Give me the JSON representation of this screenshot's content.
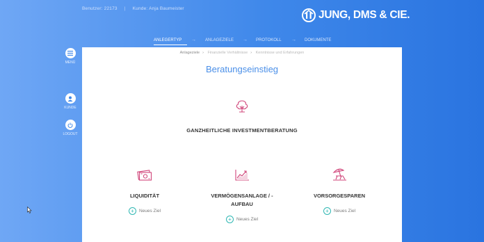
{
  "header": {
    "user_label": "Benutzer: 22173",
    "separator": "|",
    "customer_label": "Kunde: Anja Baumeister",
    "logo_text": "JUNG, DMS & CIE."
  },
  "steps": [
    {
      "label": "ANLEGERTYP",
      "active": true
    },
    {
      "label": "ANLAGEZIELE",
      "active": false
    },
    {
      "label": "PROTOKOLL",
      "active": false
    },
    {
      "label": "DOKUMENTE",
      "active": false
    }
  ],
  "sidebar": {
    "menu_label": "MENÜ",
    "customer_label": "KUNDE",
    "logout_label": "LOGOUT"
  },
  "panel": {
    "breadcrumbs": [
      "Anlageziele",
      "Finanzielle Verhältnisse",
      "Kenntnisse und Erfahrungen"
    ],
    "title": "Beratungseinstieg",
    "main_label": "GANZHEITLICHE INVESTMENTBERATUNG",
    "cards": [
      {
        "label": "LIQUIDITÄT",
        "add": "Neues Ziel",
        "icon": "money-icon"
      },
      {
        "label_line1": "VERMÖGENSANLAGE / -",
        "label_line2": "AUFBAU",
        "add": "Neues Ziel",
        "icon": "chart-growth-icon"
      },
      {
        "label": "VORSORGESPAREN",
        "add": "Neues Ziel",
        "icon": "beach-chair-icon"
      }
    ]
  },
  "colors": {
    "accent_title": "#4a8fe8",
    "icon_pink": "#d0457a",
    "plus_teal": "#2fb7b3"
  }
}
